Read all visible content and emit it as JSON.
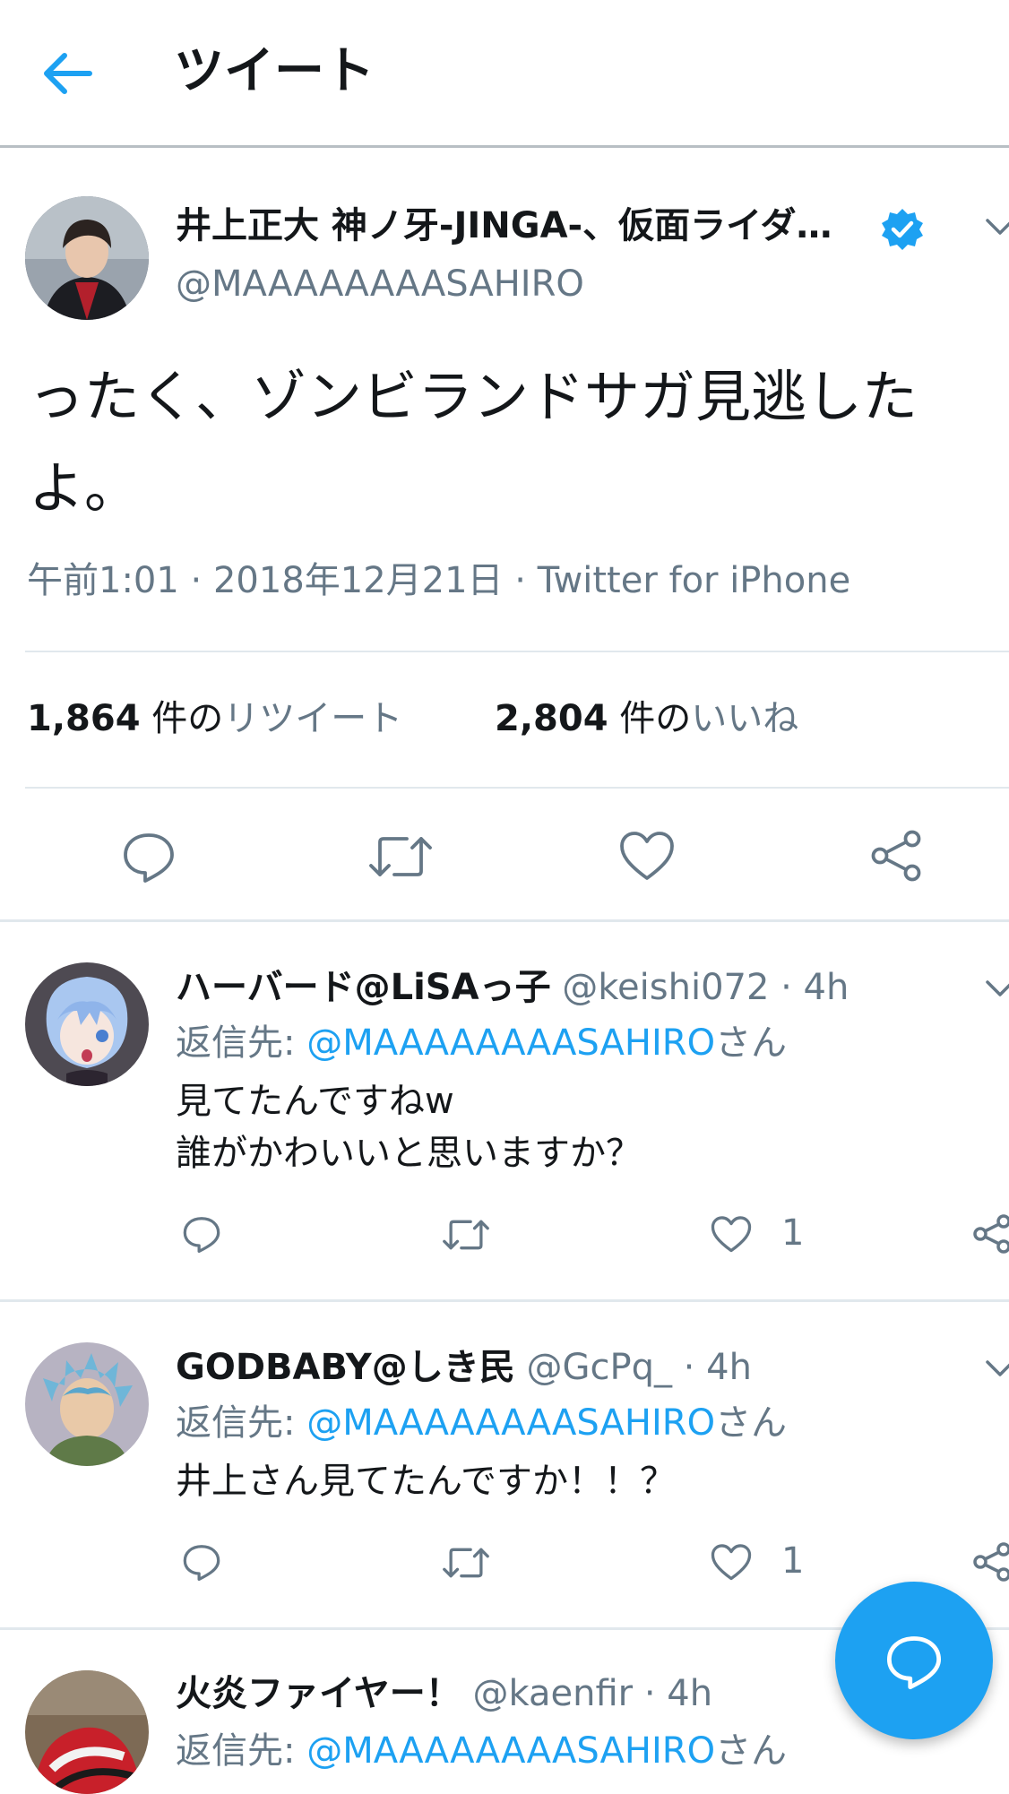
{
  "header": {
    "title": "ツイート"
  },
  "main_tweet": {
    "author": "井上正大 神ノ牙-JINGA-、仮面ライダ…",
    "handle": "@MAAAAAAAASAHIRO",
    "text": "ったく、ゾンビランドサガ見逃したよ。",
    "meta": "午前1:01 · 2018年12月21日 · Twitter for iPhone",
    "retweets_count": "1,864",
    "retweets_mid": "件の",
    "retweets_label": "リツイート",
    "likes_count": "2,804",
    "likes_mid": "件の",
    "likes_label": "いいね"
  },
  "replies": [
    {
      "name": "ハーバード@LiSAっ子",
      "handle_time": "@keishi072 · 4h",
      "reply_prefix": "返信先: ",
      "mention": "@MAAAAAAAASAHIRO",
      "reply_suffix": "さん",
      "text": "見てたんですねw\n誰がかわいいと思いますか？",
      "likes": "1"
    },
    {
      "name": "GODBABY@しき民",
      "handle_time": "@GcPq_ · 4h",
      "reply_prefix": "返信先: ",
      "mention": "@MAAAAAAAASAHIRO",
      "reply_suffix": "さん",
      "text": "井上さん見てたんですか！！？",
      "likes": "1"
    },
    {
      "name": "火炎ファイヤー！",
      "handle_time": "@kaenfir · 4h",
      "reply_prefix": "返信先: ",
      "mention": "@MAAAAAAAASAHIRO",
      "reply_suffix": "さん"
    }
  ],
  "colors": {
    "accent": "#1da1f2",
    "text": "#14171a",
    "secondary": "#657786",
    "divider": "#e1e8ed"
  },
  "icons": [
    "back-arrow-icon",
    "verified-badge-icon",
    "chevron-down-icon",
    "reply-icon",
    "retweet-icon",
    "like-icon",
    "share-icon",
    "compose-reply-icon"
  ]
}
